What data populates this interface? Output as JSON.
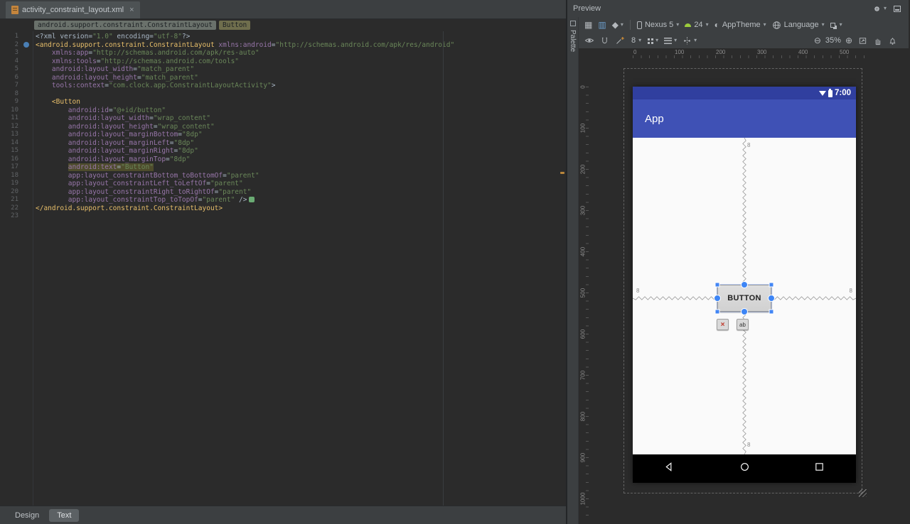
{
  "icons": {
    "close": "×",
    "dropdown": "▾",
    "grid": "▦",
    "grid_blue": "▥",
    "diamond": "◆",
    "half_circle": "◐",
    "zoom_out": "⊖",
    "zoom_in": "⊕"
  },
  "editor": {
    "tab": {
      "title": "activity_constraint_layout.xml"
    },
    "breadcrumbs": [
      "android.support.constraint.ConstraintLayout",
      "Button"
    ],
    "bottom_tabs": [
      {
        "label": "Design"
      },
      {
        "label": "Text"
      }
    ],
    "code": {
      "gutter_icons": {
        "2": "class"
      },
      "lines": [
        [
          [
            "p",
            "<?xml version="
          ],
          [
            "v",
            "\"1.0\""
          ],
          [
            "p",
            " encoding="
          ],
          [
            "v",
            "\"utf-8\""
          ],
          [
            "p",
            "?>"
          ]
        ],
        [
          [
            "t",
            "<android.support.constraint.ConstraintLayout"
          ],
          [
            "p",
            " "
          ],
          [
            "a",
            "xmlns:android"
          ],
          [
            "p",
            "="
          ],
          [
            "v",
            "\"http://schemas.android.com/apk/res/android\""
          ]
        ],
        [
          [
            "p",
            "    "
          ],
          [
            "a",
            "xmlns:app"
          ],
          [
            "p",
            "="
          ],
          [
            "v",
            "\"http://schemas.android.com/apk/res-auto\""
          ]
        ],
        [
          [
            "p",
            "    "
          ],
          [
            "a",
            "xmlns:tools"
          ],
          [
            "p",
            "="
          ],
          [
            "v",
            "\"http://schemas.android.com/tools\""
          ]
        ],
        [
          [
            "p",
            "    "
          ],
          [
            "a",
            "android:layout_width"
          ],
          [
            "p",
            "="
          ],
          [
            "v",
            "\"match_parent\""
          ]
        ],
        [
          [
            "p",
            "    "
          ],
          [
            "a",
            "android:layout_height"
          ],
          [
            "p",
            "="
          ],
          [
            "v",
            "\"match_parent\""
          ]
        ],
        [
          [
            "p",
            "    "
          ],
          [
            "a",
            "tools:context"
          ],
          [
            "p",
            "="
          ],
          [
            "v",
            "\"com.clock.app.ConstraintLayoutActivity\""
          ],
          [
            "p",
            ">"
          ]
        ],
        [],
        [
          [
            "p",
            "    "
          ],
          [
            "t",
            "<Button"
          ]
        ],
        [
          [
            "p",
            "        "
          ],
          [
            "a",
            "android:id"
          ],
          [
            "p",
            "="
          ],
          [
            "v",
            "\"@+id/button\""
          ]
        ],
        [
          [
            "p",
            "        "
          ],
          [
            "a",
            "android:layout_width"
          ],
          [
            "p",
            "="
          ],
          [
            "v",
            "\"wrap_content\""
          ]
        ],
        [
          [
            "p",
            "        "
          ],
          [
            "a",
            "android:layout_height"
          ],
          [
            "p",
            "="
          ],
          [
            "v",
            "\"wrap_content\""
          ]
        ],
        [
          [
            "p",
            "        "
          ],
          [
            "a",
            "android:layout_marginBottom"
          ],
          [
            "p",
            "="
          ],
          [
            "v",
            "\"8dp\""
          ]
        ],
        [
          [
            "p",
            "        "
          ],
          [
            "a",
            "android:layout_marginLeft"
          ],
          [
            "p",
            "="
          ],
          [
            "v",
            "\"8dp\""
          ]
        ],
        [
          [
            "p",
            "        "
          ],
          [
            "a",
            "android:layout_marginRight"
          ],
          [
            "p",
            "="
          ],
          [
            "v",
            "\"8dp\""
          ]
        ],
        [
          [
            "p",
            "        "
          ],
          [
            "a",
            "android:layout_marginTop"
          ],
          [
            "p",
            "="
          ],
          [
            "v",
            "\"8dp\""
          ]
        ],
        [
          [
            "p",
            "        "
          ],
          [
            "ah",
            "android:text"
          ],
          [
            "ph",
            "="
          ],
          [
            "vh",
            "\"Button\""
          ]
        ],
        [
          [
            "p",
            "        "
          ],
          [
            "a",
            "app:layout_constraintBottom_toBottomOf"
          ],
          [
            "p",
            "="
          ],
          [
            "v",
            "\"parent\""
          ]
        ],
        [
          [
            "p",
            "        "
          ],
          [
            "a",
            "app:layout_constraintLeft_toLeftOf"
          ],
          [
            "p",
            "="
          ],
          [
            "v",
            "\"parent\""
          ]
        ],
        [
          [
            "p",
            "        "
          ],
          [
            "a",
            "app:layout_constraintRight_toRightOf"
          ],
          [
            "p",
            "="
          ],
          [
            "v",
            "\"parent\""
          ]
        ],
        [
          [
            "p",
            "        "
          ],
          [
            "a",
            "app:layout_constraintTop_toTopOf"
          ],
          [
            "p",
            "="
          ],
          [
            "v",
            "\"parent\""
          ],
          [
            "p",
            " />"
          ],
          [
            "i",
            ""
          ]
        ],
        [
          [
            "t",
            "</android.support.constraint.ConstraintLayout>"
          ]
        ],
        []
      ]
    }
  },
  "preview": {
    "title": "Preview",
    "palette_label": "Palette",
    "toolbar": {
      "device": "Nexus 5",
      "api": "24",
      "theme": "AppTheme",
      "language": "Language",
      "default_margin": "8",
      "zoom": "35%"
    },
    "rulers": {
      "h": [
        "0",
        "100",
        "200",
        "300",
        "400",
        "500"
      ],
      "v": [
        "0",
        "100",
        "200",
        "300",
        "400",
        "500",
        "600",
        "700",
        "800",
        "900",
        "1000"
      ]
    },
    "device": {
      "time": "7:00",
      "app_title": "App",
      "button_label": "BUTTON",
      "margin_label": "8",
      "action_ab": "ab"
    }
  }
}
